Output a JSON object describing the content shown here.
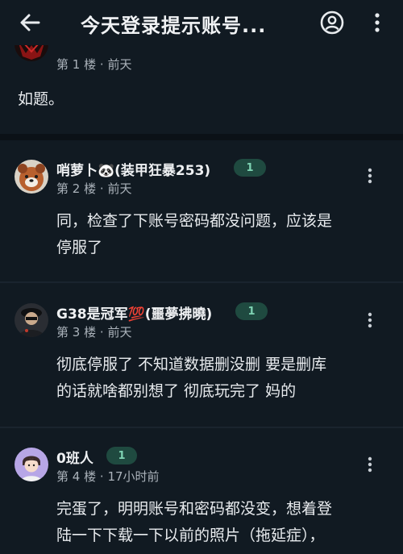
{
  "header": {
    "title": "今天登录提示账号..."
  },
  "posts": [
    {
      "floor": "第 1 楼",
      "time": "前天",
      "content": "如题。"
    },
    {
      "username": "哨萝卜🐼(装甲狂暴253)",
      "level": "1",
      "floor": "第 2 楼",
      "time": "前天",
      "content_line1": "同，检查了下账号密码都没问题，应该是",
      "content_line2": "停服了"
    },
    {
      "username": "G38是冠军💯(噩夢拂曉)",
      "level": "1",
      "floor": "第 3 楼",
      "time": "前天",
      "content_line1": "彻底停服了 不知道数据删没删 要是删库",
      "content_line2": "的话就啥都别想了 彻底玩完了 妈的"
    },
    {
      "username": "0班人",
      "level": "1",
      "floor": "第 4 楼",
      "time": "17小时前",
      "content_line1": "完蛋了，明明账号和密码都没变，想着登",
      "content_line2": "陆一下下载一下以前的照片（拖延症），"
    }
  ],
  "separator": "·",
  "colors": {
    "background": "#111a22",
    "divider": "#0b1117",
    "badge_bg": "#1f4a40",
    "badge_text": "#7ed3b3"
  }
}
